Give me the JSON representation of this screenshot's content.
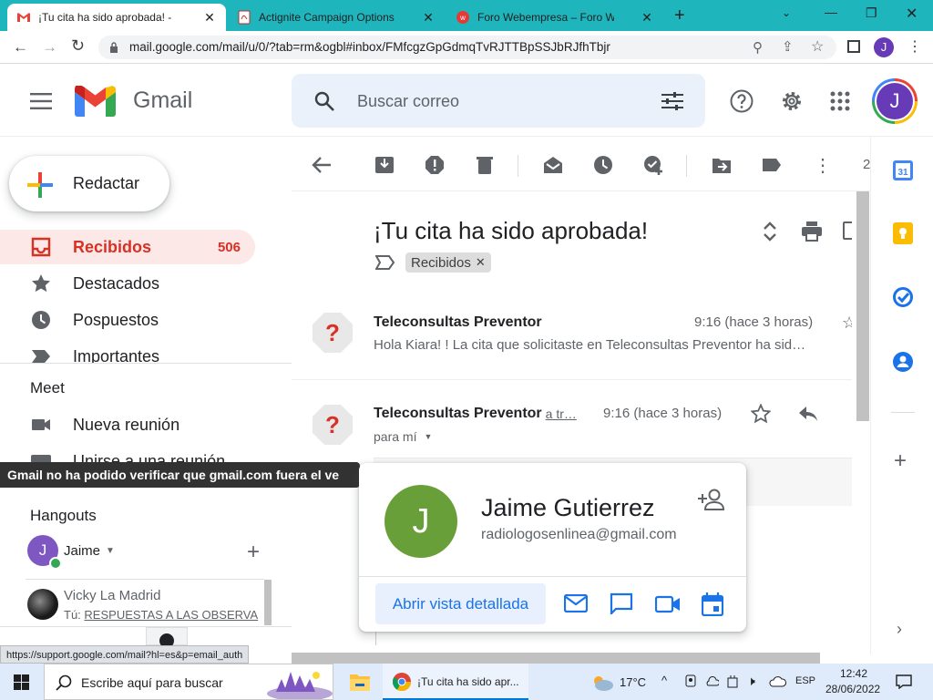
{
  "browser": {
    "tabs": [
      {
        "title": "¡Tu cita ha sido aprobada! - radio",
        "active": true
      },
      {
        "title": "Actignite Campaign Options < TE",
        "active": false
      },
      {
        "title": "Foro Webempresa – Foro WordP",
        "active": false
      }
    ],
    "url": "mail.google.com/mail/u/0/?tab=rm&ogbl#inbox/FMfcgzGpGdmqTvRJTTBpSSJbRJfhTbjr",
    "profile_initial": "J"
  },
  "gmail": {
    "logo_text": "Gmail",
    "search_placeholder": "Buscar correo",
    "avatar_initial": "J"
  },
  "sidebar": {
    "compose_label": "Redactar",
    "items": [
      {
        "label": "Recibidos",
        "count": "506",
        "icon": "inbox-icon"
      },
      {
        "label": "Destacados",
        "count": "",
        "icon": "star-icon"
      },
      {
        "label": "Pospuestos",
        "count": "",
        "icon": "clock-icon"
      },
      {
        "label": "Importantes",
        "count": "",
        "icon": "label-important-icon"
      }
    ],
    "meet_title": "Meet",
    "meet_items": [
      "Nueva reunión",
      "Unirse a una reunión"
    ],
    "hangouts_title": "Hangouts",
    "hangouts_user": "Jaime",
    "hangouts_user_initial": "J",
    "chat": {
      "name": "Vicky La Madrid",
      "prefix": "Tú:",
      "message": "RESPUESTAS A LAS OBSERVA"
    }
  },
  "toolbar": {
    "page_indicator": "2"
  },
  "email": {
    "subject": "¡Tu cita ha sido aprobada!",
    "label_chip": "Recibidos",
    "messages": [
      {
        "sender": "Teleconsultas Preventor",
        "time": "9:16 (hace 3 horas)",
        "snippet": "Hola Kiara! ! La cita que solicitaste en Teleconsultas Preventor ha sid…"
      },
      {
        "sender": "Teleconsultas Preventor",
        "via": "a tr…",
        "time": "9:16 (hace 3 horas)",
        "to_line": "para mí"
      }
    ]
  },
  "toast": "Gmail no ha podido verificar que gmail.com fuera el ve",
  "popup": {
    "name": "Jaime Gutierrez",
    "email": "radiologosenlinea@gmail.com",
    "initial": "J",
    "details_button": "Abrir vista detallada"
  },
  "status_url": "https://support.google.com/mail?hl=es&p=email_auth",
  "taskbar": {
    "search_placeholder": "Escribe aquí para buscar",
    "app_label": "¡Tu cita ha sido apr...",
    "temperature": "17°C",
    "language": "ESP",
    "time": "12:42",
    "date": "28/06/2022"
  },
  "colors": {
    "tab_bar": "#1fb5bd",
    "gmail_red": "#d93025",
    "avatar_purple": "#673ab7",
    "popup_avatar": "#689f38",
    "link_blue": "#1a73e8"
  }
}
